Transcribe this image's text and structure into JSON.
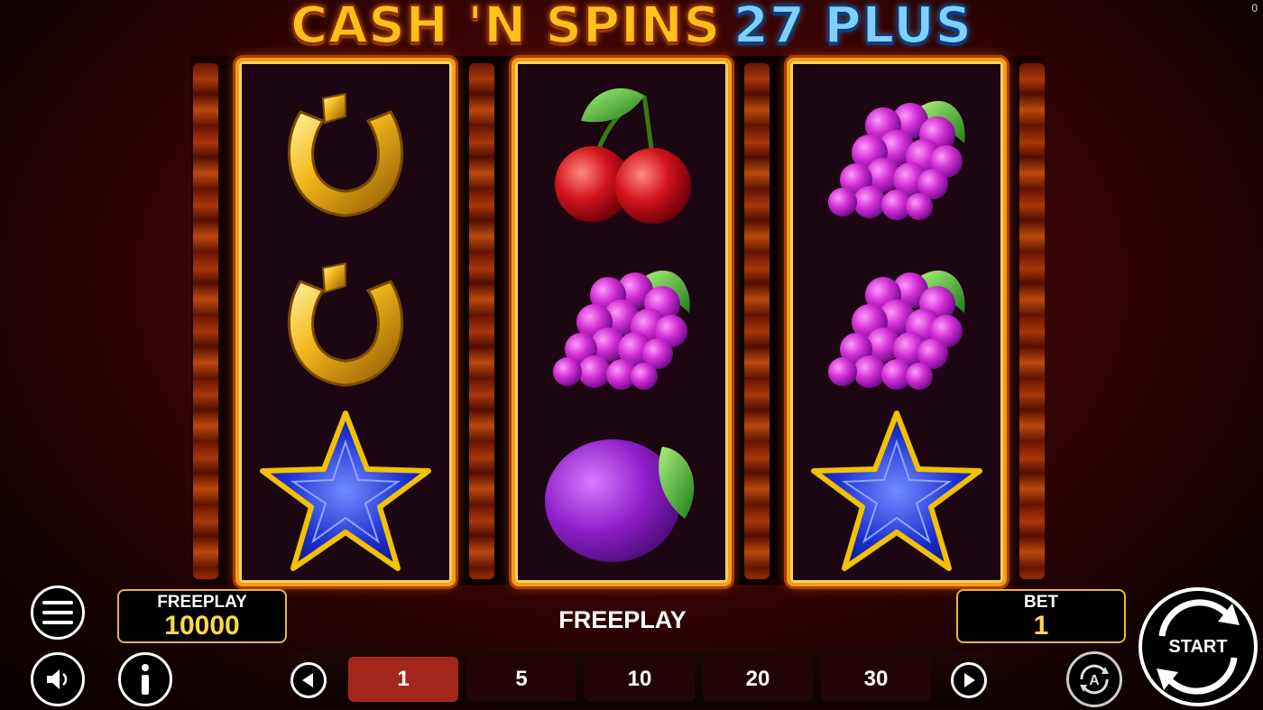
{
  "title": {
    "main": "CASH 'N SPINS",
    "plus": "27 PLUS"
  },
  "corner_counter": "0",
  "reels": [
    {
      "symbols": [
        "horseshoe",
        "horseshoe",
        "blue-star"
      ]
    },
    {
      "symbols": [
        "cherries",
        "grapes",
        "plum"
      ]
    },
    {
      "symbols": [
        "grapes",
        "grapes",
        "blue-star"
      ]
    }
  ],
  "balance": {
    "label": "FREEPLAY",
    "value": "10000"
  },
  "status_text": "FREEPLAY",
  "bet": {
    "label": "BET",
    "value": "1"
  },
  "bet_options": [
    "1",
    "5",
    "10",
    "20",
    "30"
  ],
  "selected_bet": "1",
  "start_label": "START",
  "icons": [
    "menu-icon",
    "sound-icon",
    "info-icon",
    "arrow-left-icon",
    "arrow-right-icon",
    "autoplay-icon",
    "spin-arrows-icon"
  ],
  "colors": {
    "accent_gold": "#e9b73a",
    "selected_bet": "#a3261b",
    "value_yellow": "#ffd84a"
  }
}
